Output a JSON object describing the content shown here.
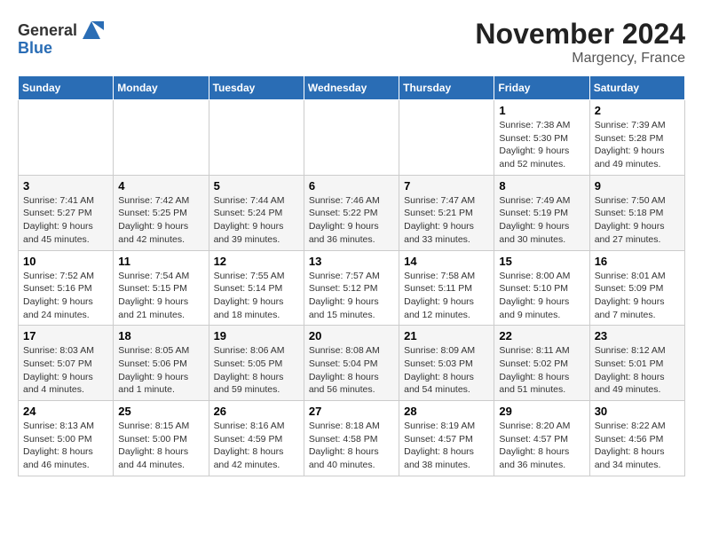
{
  "logo": {
    "general": "General",
    "blue": "Blue"
  },
  "header": {
    "month": "November 2024",
    "location": "Margency, France"
  },
  "weekdays": [
    "Sunday",
    "Monday",
    "Tuesday",
    "Wednesday",
    "Thursday",
    "Friday",
    "Saturday"
  ],
  "weeks": [
    [
      {
        "day": "",
        "info": ""
      },
      {
        "day": "",
        "info": ""
      },
      {
        "day": "",
        "info": ""
      },
      {
        "day": "",
        "info": ""
      },
      {
        "day": "",
        "info": ""
      },
      {
        "day": "1",
        "info": "Sunrise: 7:38 AM\nSunset: 5:30 PM\nDaylight: 9 hours\nand 52 minutes."
      },
      {
        "day": "2",
        "info": "Sunrise: 7:39 AM\nSunset: 5:28 PM\nDaylight: 9 hours\nand 49 minutes."
      }
    ],
    [
      {
        "day": "3",
        "info": "Sunrise: 7:41 AM\nSunset: 5:27 PM\nDaylight: 9 hours\nand 45 minutes."
      },
      {
        "day": "4",
        "info": "Sunrise: 7:42 AM\nSunset: 5:25 PM\nDaylight: 9 hours\nand 42 minutes."
      },
      {
        "day": "5",
        "info": "Sunrise: 7:44 AM\nSunset: 5:24 PM\nDaylight: 9 hours\nand 39 minutes."
      },
      {
        "day": "6",
        "info": "Sunrise: 7:46 AM\nSunset: 5:22 PM\nDaylight: 9 hours\nand 36 minutes."
      },
      {
        "day": "7",
        "info": "Sunrise: 7:47 AM\nSunset: 5:21 PM\nDaylight: 9 hours\nand 33 minutes."
      },
      {
        "day": "8",
        "info": "Sunrise: 7:49 AM\nSunset: 5:19 PM\nDaylight: 9 hours\nand 30 minutes."
      },
      {
        "day": "9",
        "info": "Sunrise: 7:50 AM\nSunset: 5:18 PM\nDaylight: 9 hours\nand 27 minutes."
      }
    ],
    [
      {
        "day": "10",
        "info": "Sunrise: 7:52 AM\nSunset: 5:16 PM\nDaylight: 9 hours\nand 24 minutes."
      },
      {
        "day": "11",
        "info": "Sunrise: 7:54 AM\nSunset: 5:15 PM\nDaylight: 9 hours\nand 21 minutes."
      },
      {
        "day": "12",
        "info": "Sunrise: 7:55 AM\nSunset: 5:14 PM\nDaylight: 9 hours\nand 18 minutes."
      },
      {
        "day": "13",
        "info": "Sunrise: 7:57 AM\nSunset: 5:12 PM\nDaylight: 9 hours\nand 15 minutes."
      },
      {
        "day": "14",
        "info": "Sunrise: 7:58 AM\nSunset: 5:11 PM\nDaylight: 9 hours\nand 12 minutes."
      },
      {
        "day": "15",
        "info": "Sunrise: 8:00 AM\nSunset: 5:10 PM\nDaylight: 9 hours\nand 9 minutes."
      },
      {
        "day": "16",
        "info": "Sunrise: 8:01 AM\nSunset: 5:09 PM\nDaylight: 9 hours\nand 7 minutes."
      }
    ],
    [
      {
        "day": "17",
        "info": "Sunrise: 8:03 AM\nSunset: 5:07 PM\nDaylight: 9 hours\nand 4 minutes."
      },
      {
        "day": "18",
        "info": "Sunrise: 8:05 AM\nSunset: 5:06 PM\nDaylight: 9 hours\nand 1 minute."
      },
      {
        "day": "19",
        "info": "Sunrise: 8:06 AM\nSunset: 5:05 PM\nDaylight: 8 hours\nand 59 minutes."
      },
      {
        "day": "20",
        "info": "Sunrise: 8:08 AM\nSunset: 5:04 PM\nDaylight: 8 hours\nand 56 minutes."
      },
      {
        "day": "21",
        "info": "Sunrise: 8:09 AM\nSunset: 5:03 PM\nDaylight: 8 hours\nand 54 minutes."
      },
      {
        "day": "22",
        "info": "Sunrise: 8:11 AM\nSunset: 5:02 PM\nDaylight: 8 hours\nand 51 minutes."
      },
      {
        "day": "23",
        "info": "Sunrise: 8:12 AM\nSunset: 5:01 PM\nDaylight: 8 hours\nand 49 minutes."
      }
    ],
    [
      {
        "day": "24",
        "info": "Sunrise: 8:13 AM\nSunset: 5:00 PM\nDaylight: 8 hours\nand 46 minutes."
      },
      {
        "day": "25",
        "info": "Sunrise: 8:15 AM\nSunset: 5:00 PM\nDaylight: 8 hours\nand 44 minutes."
      },
      {
        "day": "26",
        "info": "Sunrise: 8:16 AM\nSunset: 4:59 PM\nDaylight: 8 hours\nand 42 minutes."
      },
      {
        "day": "27",
        "info": "Sunrise: 8:18 AM\nSunset: 4:58 PM\nDaylight: 8 hours\nand 40 minutes."
      },
      {
        "day": "28",
        "info": "Sunrise: 8:19 AM\nSunset: 4:57 PM\nDaylight: 8 hours\nand 38 minutes."
      },
      {
        "day": "29",
        "info": "Sunrise: 8:20 AM\nSunset: 4:57 PM\nDaylight: 8 hours\nand 36 minutes."
      },
      {
        "day": "30",
        "info": "Sunrise: 8:22 AM\nSunset: 4:56 PM\nDaylight: 8 hours\nand 34 minutes."
      }
    ]
  ]
}
